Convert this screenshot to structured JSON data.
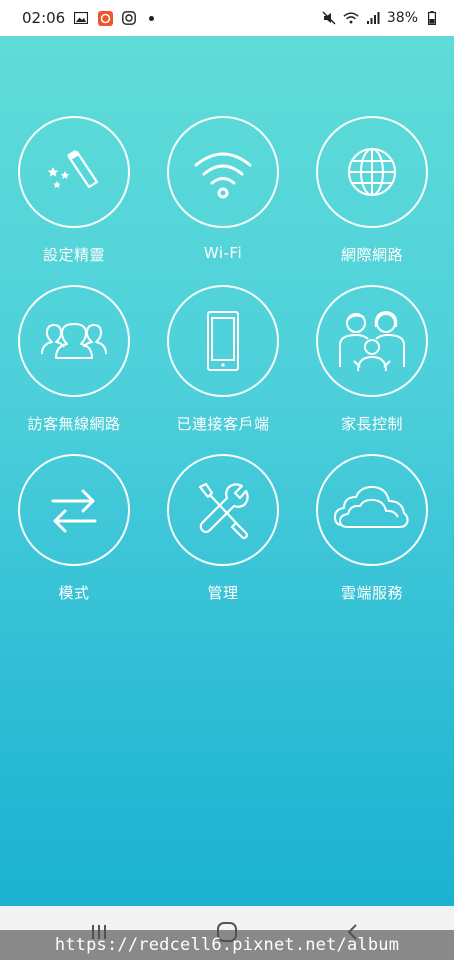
{
  "status_bar": {
    "time": "02:06",
    "battery": "38%",
    "left_icons": [
      "gallery-icon",
      "app-notification-icon",
      "instagram-icon"
    ],
    "right_icons": [
      "mute-icon",
      "wifi-status-icon",
      "signal-icon",
      "battery-icon"
    ]
  },
  "tiles": [
    {
      "label": "設定精靈",
      "icon": "magic-wand-icon"
    },
    {
      "label": "Wi-Fi",
      "icon": "wifi-icon"
    },
    {
      "label": "網際網路",
      "icon": "globe-icon"
    },
    {
      "label": "訪客無線網路",
      "icon": "guests-icon"
    },
    {
      "label": "已連接客戶端",
      "icon": "phone-icon"
    },
    {
      "label": "家長控制",
      "icon": "family-icon"
    },
    {
      "label": "模式",
      "icon": "switch-arrows-icon"
    },
    {
      "label": "管理",
      "icon": "tools-icon"
    },
    {
      "label": "雲端服務",
      "icon": "cloud-icon"
    }
  ],
  "nav_bar": {
    "buttons": [
      "recent-apps-button",
      "home-button",
      "back-button"
    ]
  },
  "watermark": "https://redcell6.pixnet.net/album",
  "colors": {
    "gradient_top": "#5fdcd8",
    "gradient_bottom": "#1bb2d1",
    "foreground": "#ffffff"
  }
}
